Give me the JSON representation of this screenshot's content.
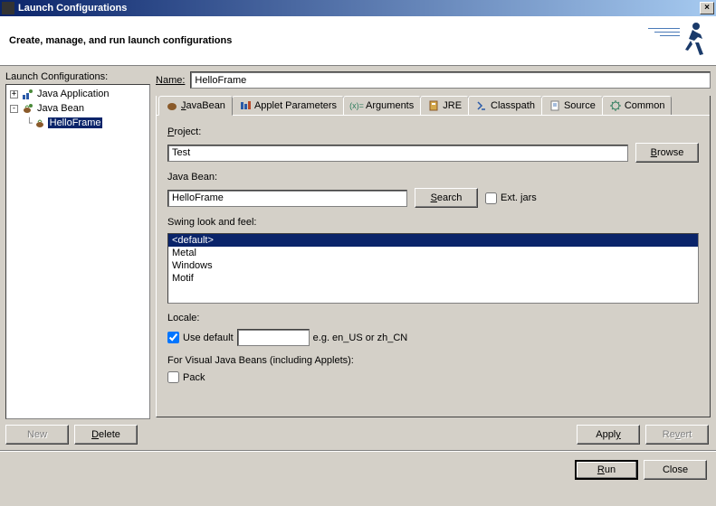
{
  "title": "Launch Configurations",
  "banner": "Create, manage, and run launch configurations",
  "left": {
    "label": "Launch Configurations:",
    "items": [
      {
        "label": "Java Application",
        "expand": "+"
      },
      {
        "label": "Java Bean",
        "expand": "-"
      },
      {
        "label": "HelloFrame",
        "selected": true
      }
    ],
    "new_btn": "New",
    "delete_btn": "Delete"
  },
  "name_label": "Name:",
  "name_value": "HelloFrame",
  "tabs": [
    {
      "label": "JavaBean",
      "active": true
    },
    {
      "label": "Applet Parameters"
    },
    {
      "label": "Arguments"
    },
    {
      "label": "JRE"
    },
    {
      "label": "Classpath"
    },
    {
      "label": "Source"
    },
    {
      "label": "Common"
    }
  ],
  "form": {
    "project_label": "Project:",
    "project_value": "Test",
    "browse_btn": "Browse",
    "bean_label": "Java Bean:",
    "bean_value": "HelloFrame",
    "search_btn": "Search",
    "ext_jars_label": "Ext. jars",
    "swing_label": "Swing look and feel:",
    "swing_options": [
      "<default>",
      "Metal",
      "Windows",
      "Motif"
    ],
    "locale_label": "Locale:",
    "use_default_label": "Use default",
    "locale_hint": "e.g. en_US or zh_CN",
    "visual_label": "For Visual Java Beans (including Applets):",
    "pack_label": "Pack"
  },
  "apply_btn": "Apply",
  "revert_btn": "Revert",
  "run_btn": "Run",
  "close_btn": "Close"
}
